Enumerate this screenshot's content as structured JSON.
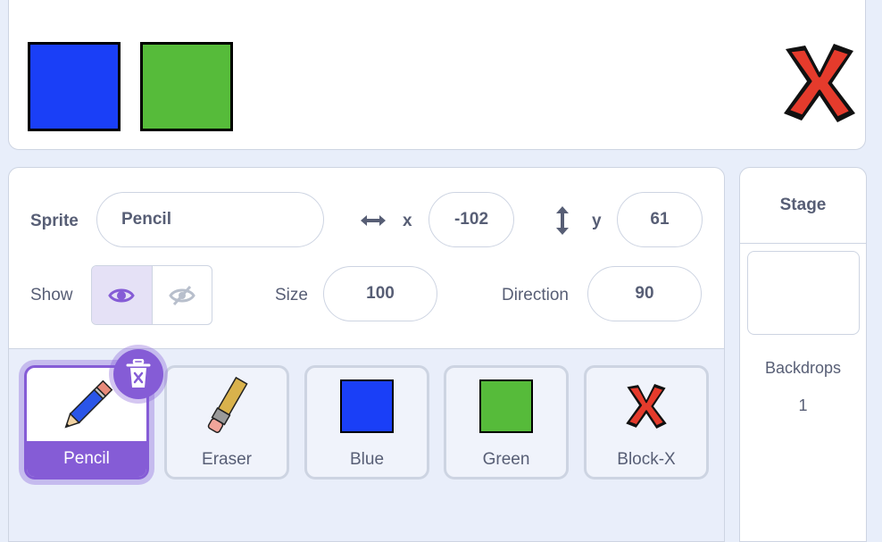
{
  "stage": {
    "sprites": [
      {
        "name": "blue-square",
        "color": "#1a3ff7"
      },
      {
        "name": "green-square",
        "color": "#56bb3a"
      },
      {
        "name": "block-x",
        "color": "#e53b2c"
      }
    ]
  },
  "sprite_info": {
    "sprite_label": "Sprite",
    "sprite_name": "Pencil",
    "x_label": "x",
    "x_value": "-102",
    "y_label": "y",
    "y_value": "61",
    "show_label": "Show",
    "show_visible": true,
    "size_label": "Size",
    "size_value": "100",
    "direction_label": "Direction",
    "direction_value": "90"
  },
  "sprite_list": [
    {
      "name": "Pencil",
      "selected": true,
      "icon": "pencil-icon"
    },
    {
      "name": "Eraser",
      "selected": false,
      "icon": "eraser-icon"
    },
    {
      "name": "Blue",
      "selected": false,
      "color": "#1a3ff7"
    },
    {
      "name": "Green",
      "selected": false,
      "color": "#56bb3a"
    },
    {
      "name": "Block-X",
      "selected": false,
      "icon": "block-x-icon"
    }
  ],
  "stage_pane": {
    "title": "Stage",
    "backdrops_label": "Backdrops",
    "backdrops_count": "1"
  },
  "colors": {
    "accent": "#855cd6",
    "panel_bg": "#e9eefa",
    "text": "#575e75"
  }
}
